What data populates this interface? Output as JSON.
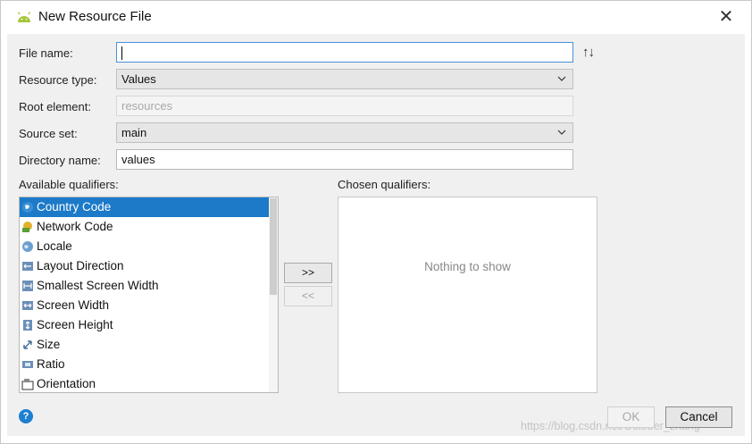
{
  "window": {
    "title": "New Resource File",
    "close_glyph": "✕",
    "app_icon": "android-icon"
  },
  "form": {
    "file_name": {
      "label": "File name:",
      "value": ""
    },
    "sort_glyph": "↑↓",
    "resource_type": {
      "label": "Resource type:",
      "value": "Values"
    },
    "root_element": {
      "label": "Root element:",
      "placeholder": "resources"
    },
    "source_set": {
      "label": "Source set:",
      "value": "main"
    },
    "directory_name": {
      "label": "Directory name:",
      "value": "values"
    }
  },
  "qualifiers": {
    "available_label": "Available qualifiers:",
    "chosen_label": "Chosen qualifiers:",
    "available": [
      {
        "label": "Country Code",
        "icon": "country-code-icon",
        "selected": true
      },
      {
        "label": "Network Code",
        "icon": "network-code-icon",
        "selected": false
      },
      {
        "label": "Locale",
        "icon": "locale-icon",
        "selected": false
      },
      {
        "label": "Layout Direction",
        "icon": "layout-direction-icon",
        "selected": false
      },
      {
        "label": "Smallest Screen Width",
        "icon": "smallest-screen-width-icon",
        "selected": false
      },
      {
        "label": "Screen Width",
        "icon": "screen-width-icon",
        "selected": false
      },
      {
        "label": "Screen Height",
        "icon": "screen-height-icon",
        "selected": false
      },
      {
        "label": "Size",
        "icon": "size-icon",
        "selected": false
      },
      {
        "label": "Ratio",
        "icon": "ratio-icon",
        "selected": false
      },
      {
        "label": "Orientation",
        "icon": "orientation-icon",
        "selected": false
      }
    ],
    "add_label": ">>",
    "remove_label": "<<",
    "empty_text": "Nothing to show"
  },
  "footer": {
    "help_glyph": "?",
    "ok_label": "OK",
    "cancel_label": "Cancel"
  },
  "watermark": "https://blog.csdn.net/October_zhang",
  "colors": {
    "selection": "#1c7ac9",
    "help": "#1d7fd1",
    "android": "#a4c639"
  }
}
